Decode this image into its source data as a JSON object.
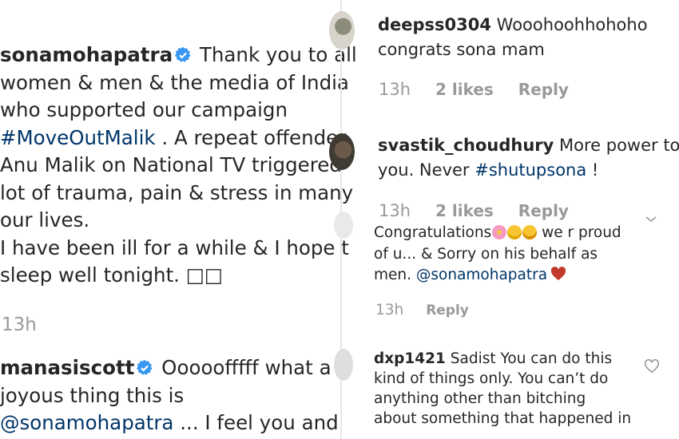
{
  "left": {
    "post": {
      "username": "sonamohapatra",
      "line1_text": " Thank you to all",
      "line2": "women & men & the media of India",
      "line3": "who supported our campaign",
      "hashtag": "#MoveOutMalik",
      "line4_rest": " . A repeat offender",
      "line5": "Anu Malik on National TV triggered",
      "line6": "lot of trauma, pain & stress in many",
      "line7": "our lives.",
      "line8": "I have been ill for a while & I hope t",
      "line9": "sleep well tonight. □□",
      "time": "13h"
    },
    "comment": {
      "username": "manasiscott",
      "line1_text": " Ooooofffff what a",
      "line2": "joyous thing this is",
      "mention": "@sonamohapatra",
      "line3_rest": " ... I feel you and"
    }
  },
  "right": {
    "c1": {
      "username": "deepss0304",
      "text1": " Wooohoohhohoho",
      "text2": "congrats sona mam",
      "time": "13h",
      "likes": "2 likes",
      "reply": "Reply"
    },
    "c2": {
      "username": "svastik_choudhury",
      "text1": " More power to",
      "text2a": "you. Never ",
      "hashtag": "#shutupsona",
      "text2b": " !",
      "time": "13h",
      "likes": "2 likes",
      "reply": "Reply"
    },
    "c3": {
      "text1": "Congratulations",
      "text1b": " we r proud",
      "text2": "of u... & Sorry on his behalf as",
      "text3a": "men. ",
      "mention": "@sonamohapatra",
      "time": "13h",
      "reply": "Reply"
    },
    "c4": {
      "username": "dxp1421",
      "text1": " Sadist You can do this",
      "text2": "kind of things only. You can’t do",
      "text3": "anything other than bitching",
      "text4": "about something that happened in"
    }
  },
  "icons": [
    "verified-badge-icon",
    "heart-icon",
    "chevron-down-icon",
    "flower-emoji-icon",
    "smile-emoji-icon",
    "astonished-emoji-icon"
  ],
  "colors": {
    "link": "#003569",
    "meta": "#999999",
    "verified": "#3897f0",
    "heart": "#c0392b"
  }
}
